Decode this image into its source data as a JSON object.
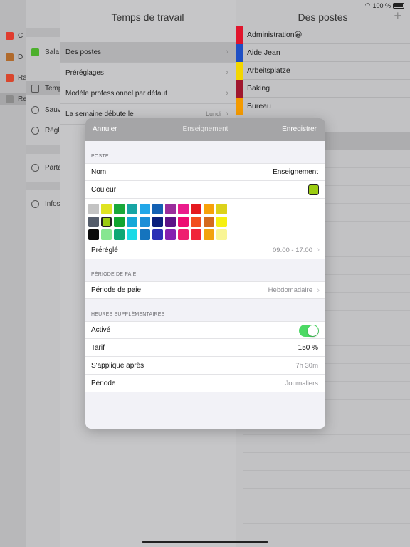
{
  "status": {
    "battery": "100 %",
    "wifi_icon": "wifi-icon"
  },
  "layer1": {
    "items": [
      {
        "label": "C",
        "color": "#e03c2f"
      },
      {
        "label": "D",
        "color": "#b06a2c"
      },
      {
        "label": "Ra",
        "color": "#d9462d"
      },
      {
        "label": "Re",
        "color": "#8a8a8a"
      }
    ]
  },
  "layer2": {
    "items": [
      {
        "label": "Sala",
        "icon": "heart-icon"
      },
      {
        "label": "Temp",
        "icon": "calendar-icon"
      },
      {
        "label": "Sauv",
        "icon": "cloud-icon"
      },
      {
        "label": "Régl",
        "icon": "gear-icon"
      },
      {
        "label": "Parta",
        "icon": "share-icon"
      },
      {
        "label": "Infos",
        "icon": "info-icon"
      }
    ]
  },
  "layer3": {
    "title": "Temps de travail",
    "rows": [
      {
        "label": "Des postes",
        "value": ""
      },
      {
        "label": "Préréglages",
        "value": ""
      },
      {
        "label": "Modèle professionnel par défaut",
        "value": ""
      },
      {
        "label": "La semaine débute le",
        "value": "Lundi"
      }
    ]
  },
  "layer4": {
    "title": "Des postes",
    "plus": "+",
    "rows": [
      {
        "label": "Administration😀",
        "color": "#e0142c"
      },
      {
        "label": "Aide Jean",
        "color": "#1f4fc4"
      },
      {
        "label": "Arbeitsplätze",
        "color": "#f3d600"
      },
      {
        "label": "Baking",
        "color": "#a0172e"
      },
      {
        "label": "Bureau",
        "color": "#f49a00"
      }
    ]
  },
  "modal": {
    "cancel": "Annuler",
    "title": "Enseignement",
    "save": "Enregistrer",
    "poste": {
      "section": "POSTE",
      "name_label": "Nom",
      "name_value": "Enseignement",
      "color_label": "Couleur",
      "selected_color": "#9bcc11",
      "preset_label": "Préréglé",
      "preset_value": "09:00 - 17:00"
    },
    "palette": [
      [
        "#c3c3c3",
        "#dfe321",
        "#19a83a",
        "#17a5a4",
        "#23a7e8",
        "#1461b3",
        "#9a2d9c",
        "#ea1c8c",
        "#e51a20",
        "#f7a10a",
        "#dcd21a"
      ],
      [
        "#555d6b",
        "#9bcc11",
        "#10a530",
        "#17a8d8",
        "#1d8fd7",
        "#0b1f7c",
        "#5d1287",
        "#ed0c72",
        "#f24e20",
        "#d46a1e",
        "#f6f010"
      ],
      [
        "#0a0a0a",
        "#87e691",
        "#0ea774",
        "#1cdae6",
        "#1574be",
        "#2b2fb5",
        "#8521b0",
        "#ee1f70",
        "#f0243a",
        "#f2a20e",
        "#f9f594"
      ]
    ],
    "paie": {
      "section": "PÉRIODE DE PAIE",
      "label": "Période de paie",
      "value": "Hebdomadaire"
    },
    "overtime": {
      "section": "HEURES SUPPLÉMENTAIRES",
      "active_label": "Activé",
      "rate_label": "Tarif",
      "rate_value": "150 %",
      "after_label": "S'applique après",
      "after_value": "7h 30m",
      "period_label": "Période",
      "period_value": "Journaliers"
    }
  }
}
